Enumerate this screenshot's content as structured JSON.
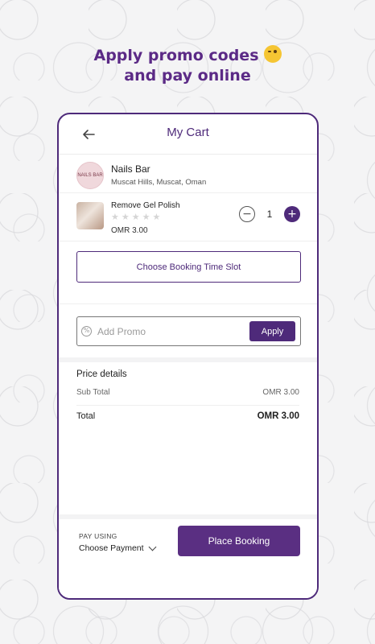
{
  "headline": {
    "line1": "Apply promo codes",
    "line2": "and pay online"
  },
  "header": {
    "title": "My Cart"
  },
  "salon": {
    "logo_text": "NAILS BAR",
    "name": "Nails Bar",
    "address": "Muscat Hills, Muscat, Oman"
  },
  "cart_item": {
    "name": "Remove Gel Polish",
    "rating": 0,
    "rating_max": 5,
    "price": "OMR 3.00",
    "quantity": "1"
  },
  "booking": {
    "slot_label": "Choose Booking Time Slot"
  },
  "promo": {
    "placeholder": "Add Promo",
    "value": "",
    "apply_label": "Apply"
  },
  "price_details": {
    "title": "Price details",
    "subtotal_label": "Sub Total",
    "subtotal_value": "OMR 3.00",
    "total_label": "Total",
    "total_value": "OMR 3.00"
  },
  "footer": {
    "pay_label": "PAY USING",
    "pay_value": "Choose Payment",
    "place_label": "Place Booking"
  },
  "colors": {
    "brand": "#4e2a7a",
    "star_empty": "#d5d5d5"
  }
}
